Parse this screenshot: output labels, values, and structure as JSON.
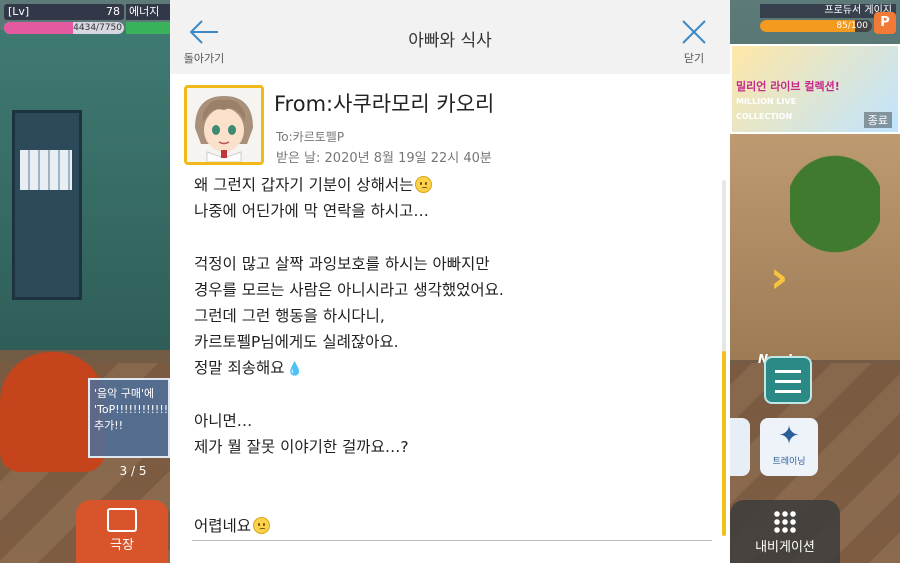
{
  "hud": {
    "level_label": "[Lv]",
    "level": "78",
    "energy_label": "에너지",
    "exp_text": "4434/7750",
    "exp_fraction": 0.572,
    "producer_gauge_label": "프로듀서 게이지",
    "producer_gauge_text": "85/100",
    "producer_gauge_fraction": 0.85,
    "producer_badge": "P"
  },
  "left": {
    "music_card_text": "'음악 구매'에 'ToP!!!!!!!!!!!!!!' 추가!!",
    "page_indicator": "3 / 5",
    "theater_label": "극장"
  },
  "right": {
    "banner_text": "밀리언 라이브 컬렉션!",
    "banner_subtext": "MILLION LIVE COLLECTION",
    "banner_status": "종료",
    "new_label": "New!",
    "training_label": "트레이닝",
    "navigation_label": "내비게이션"
  },
  "mail": {
    "title": "아빠와 식사",
    "back_label": "돌아가기",
    "close_label": "닫기",
    "from": "From:사쿠라모리 카오리",
    "to": "To:카르토펠P",
    "date": "받은 날: 2020년 8월 19일 22시 40분",
    "lines": [
      "왜 그런지 갑자기 기분이 상해서는",
      "나중에 어딘가에 막 연락을 하시고…",
      "",
      "걱정이 많고 살짝 과잉보호를 하시는 아빠지만",
      "경우를 모르는 사람은 아니시라고 생각했었어요.",
      "그런데 그런 행동을 하시다니,",
      "카르토펠P님에게도 실례잖아요.",
      "정말 죄송해요",
      "",
      "아니면…",
      "제가 뭘 잘못 이야기한 걸까요…?",
      "",
      "",
      "어렵네요"
    ],
    "scroll_fraction_start": 0.48,
    "scroll_fraction_end": 1.0
  },
  "colors": {
    "accent_yellow": "#f2b91a",
    "header_bg": "#f2f2f2",
    "icon_blue": "#3a8ac9"
  },
  "icons": {
    "back": "arrow-left-icon",
    "close": "close-icon",
    "emoji_worried": "worried-face-icon",
    "emoji_sweat": "sweat-drops-icon"
  }
}
